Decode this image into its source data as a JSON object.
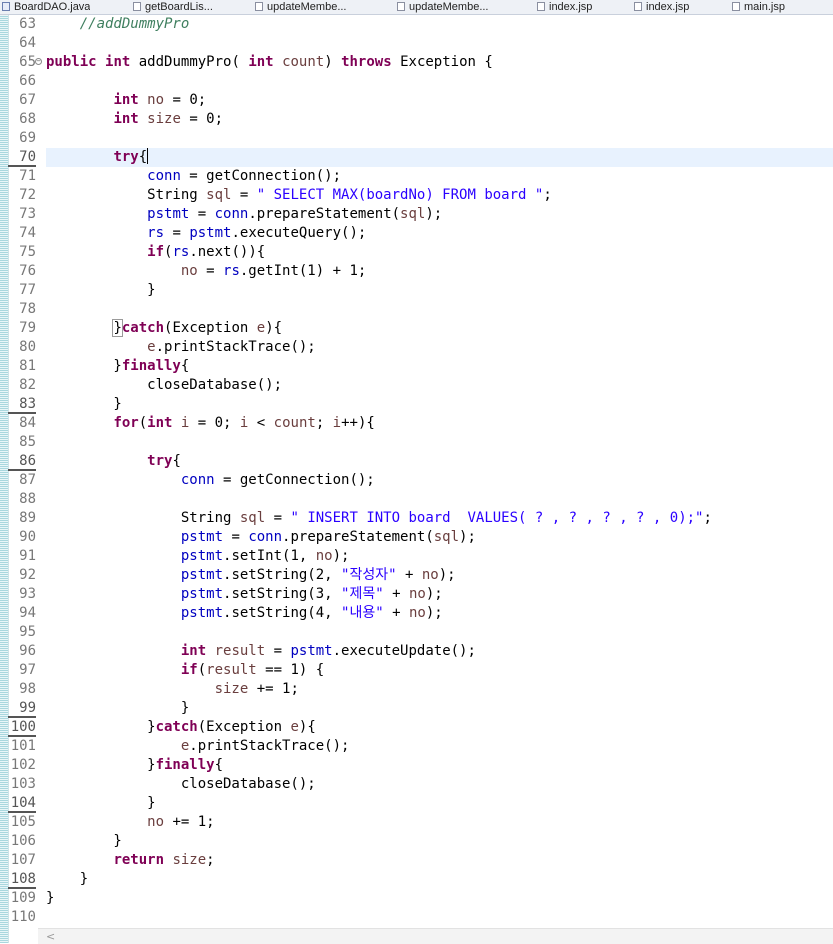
{
  "tabs": [
    {
      "label": "BoardDAO.java",
      "type": "java"
    },
    {
      "label": "getBoardLis...",
      "type": "jsp"
    },
    {
      "label": "updateMembe...",
      "type": "jsp"
    },
    {
      "label": "updateMembe...",
      "type": "jsp"
    },
    {
      "label": "index.jsp",
      "type": "jsp"
    },
    {
      "label": "index.jsp",
      "type": "jsp"
    },
    {
      "label": "main.jsp",
      "type": "jsp"
    }
  ],
  "editor": {
    "current_line": 70,
    "lines": [
      {
        "n": 63,
        "t": [
          [
            "cm",
            "    //addDummyPro"
          ]
        ]
      },
      {
        "n": 64,
        "t": []
      },
      {
        "n": 65,
        "fold": true,
        "t": [
          [
            "kw",
            "public"
          ],
          [
            "",
            " "
          ],
          [
            "kw",
            "int"
          ],
          [
            "",
            " addDummyPro( "
          ],
          [
            "kw",
            "int"
          ],
          [
            "",
            " "
          ],
          [
            "var",
            "count"
          ],
          [
            "",
            ") "
          ],
          [
            "kw",
            "throws"
          ],
          [
            "",
            " Exception {"
          ]
        ]
      },
      {
        "n": 66,
        "t": []
      },
      {
        "n": 67,
        "t": [
          [
            "",
            "        "
          ],
          [
            "kw",
            "int"
          ],
          [
            "",
            " "
          ],
          [
            "var",
            "no"
          ],
          [
            "",
            " = 0;"
          ]
        ]
      },
      {
        "n": 68,
        "t": [
          [
            "",
            "        "
          ],
          [
            "kw",
            "int"
          ],
          [
            "",
            " "
          ],
          [
            "var",
            "size"
          ],
          [
            "",
            " = 0;"
          ]
        ]
      },
      {
        "n": 69,
        "t": []
      },
      {
        "n": 70,
        "mark": true,
        "t": [
          [
            "",
            "        "
          ],
          [
            "kw",
            "try"
          ],
          [
            "",
            "{"
          ],
          [
            "caret",
            ""
          ]
        ]
      },
      {
        "n": 71,
        "t": [
          [
            "",
            "            "
          ],
          [
            "fld",
            "conn"
          ],
          [
            "",
            " = getConnection();"
          ]
        ]
      },
      {
        "n": 72,
        "t": [
          [
            "",
            "            String "
          ],
          [
            "var",
            "sql"
          ],
          [
            "",
            " = "
          ],
          [
            "str",
            "\" SELECT MAX(boardNo) FROM board \""
          ],
          [
            "",
            ";"
          ]
        ]
      },
      {
        "n": 73,
        "t": [
          [
            "",
            "            "
          ],
          [
            "fld",
            "pstmt"
          ],
          [
            "",
            " = "
          ],
          [
            "fld",
            "conn"
          ],
          [
            "",
            ".prepareStatement("
          ],
          [
            "var",
            "sql"
          ],
          [
            "",
            ");"
          ]
        ]
      },
      {
        "n": 74,
        "t": [
          [
            "",
            "            "
          ],
          [
            "fld",
            "rs"
          ],
          [
            "",
            " = "
          ],
          [
            "fld",
            "pstmt"
          ],
          [
            "",
            ".executeQuery();"
          ]
        ]
      },
      {
        "n": 75,
        "t": [
          [
            "",
            "            "
          ],
          [
            "kw",
            "if"
          ],
          [
            "",
            "("
          ],
          [
            "fld",
            "rs"
          ],
          [
            "",
            ".next()){"
          ]
        ]
      },
      {
        "n": 76,
        "t": [
          [
            "",
            "                "
          ],
          [
            "var",
            "no"
          ],
          [
            "",
            " = "
          ],
          [
            "fld",
            "rs"
          ],
          [
            "",
            ".getInt(1) + 1;"
          ]
        ]
      },
      {
        "n": 77,
        "t": [
          [
            "",
            "            }"
          ]
        ]
      },
      {
        "n": 78,
        "t": []
      },
      {
        "n": 79,
        "t": [
          [
            "",
            "        "
          ],
          [
            "box",
            "}"
          ],
          [
            "kw",
            "catch"
          ],
          [
            "",
            "(Exception "
          ],
          [
            "var",
            "e"
          ],
          [
            "",
            "){"
          ]
        ]
      },
      {
        "n": 80,
        "t": [
          [
            "",
            "            "
          ],
          [
            "var",
            "e"
          ],
          [
            "",
            ".printStackTrace();"
          ]
        ]
      },
      {
        "n": 81,
        "t": [
          [
            "",
            "        }"
          ],
          [
            "kw",
            "finally"
          ],
          [
            "",
            "{"
          ]
        ]
      },
      {
        "n": 82,
        "t": [
          [
            "",
            "            closeDatabase();"
          ]
        ]
      },
      {
        "n": 83,
        "mark": true,
        "t": [
          [
            "",
            "        }"
          ]
        ]
      },
      {
        "n": 84,
        "t": [
          [
            "",
            "        "
          ],
          [
            "kw",
            "for"
          ],
          [
            "",
            "("
          ],
          [
            "kw",
            "int"
          ],
          [
            "",
            " "
          ],
          [
            "var",
            "i"
          ],
          [
            "",
            " = 0; "
          ],
          [
            "var",
            "i"
          ],
          [
            "",
            " < "
          ],
          [
            "var",
            "count"
          ],
          [
            "",
            "; "
          ],
          [
            "var",
            "i"
          ],
          [
            "",
            "++){"
          ]
        ]
      },
      {
        "n": 85,
        "t": []
      },
      {
        "n": 86,
        "mark": true,
        "t": [
          [
            "",
            "            "
          ],
          [
            "kw",
            "try"
          ],
          [
            "",
            "{"
          ]
        ]
      },
      {
        "n": 87,
        "t": [
          [
            "",
            "                "
          ],
          [
            "fld",
            "conn"
          ],
          [
            "",
            " = getConnection();"
          ]
        ]
      },
      {
        "n": 88,
        "t": []
      },
      {
        "n": 89,
        "t": [
          [
            "",
            "                String "
          ],
          [
            "var",
            "sql"
          ],
          [
            "",
            " = "
          ],
          [
            "str",
            "\" INSERT INTO board  VALUES( ? , ? , ? , ? , 0);\""
          ],
          [
            "",
            ";"
          ]
        ]
      },
      {
        "n": 90,
        "t": [
          [
            "",
            "                "
          ],
          [
            "fld",
            "pstmt"
          ],
          [
            "",
            " = "
          ],
          [
            "fld",
            "conn"
          ],
          [
            "",
            ".prepareStatement("
          ],
          [
            "var",
            "sql"
          ],
          [
            "",
            ");"
          ]
        ]
      },
      {
        "n": 91,
        "t": [
          [
            "",
            "                "
          ],
          [
            "fld",
            "pstmt"
          ],
          [
            "",
            ".setInt(1, "
          ],
          [
            "var",
            "no"
          ],
          [
            "",
            ");"
          ]
        ]
      },
      {
        "n": 92,
        "t": [
          [
            "",
            "                "
          ],
          [
            "fld",
            "pstmt"
          ],
          [
            "",
            ".setString(2, "
          ],
          [
            "str",
            "\"작성자\""
          ],
          [
            "",
            " + "
          ],
          [
            "var",
            "no"
          ],
          [
            "",
            ");"
          ]
        ]
      },
      {
        "n": 93,
        "t": [
          [
            "",
            "                "
          ],
          [
            "fld",
            "pstmt"
          ],
          [
            "",
            ".setString(3, "
          ],
          [
            "str",
            "\"제목\""
          ],
          [
            "",
            " + "
          ],
          [
            "var",
            "no"
          ],
          [
            "",
            ");"
          ]
        ]
      },
      {
        "n": 94,
        "t": [
          [
            "",
            "                "
          ],
          [
            "fld",
            "pstmt"
          ],
          [
            "",
            ".setString(4, "
          ],
          [
            "str",
            "\"내용\""
          ],
          [
            "",
            " + "
          ],
          [
            "var",
            "no"
          ],
          [
            "",
            ");"
          ]
        ]
      },
      {
        "n": 95,
        "t": []
      },
      {
        "n": 96,
        "t": [
          [
            "",
            "                "
          ],
          [
            "kw",
            "int"
          ],
          [
            "",
            " "
          ],
          [
            "var",
            "result"
          ],
          [
            "",
            " = "
          ],
          [
            "fld",
            "pstmt"
          ],
          [
            "",
            ".executeUpdate();"
          ]
        ]
      },
      {
        "n": 97,
        "t": [
          [
            "",
            "                "
          ],
          [
            "kw",
            "if"
          ],
          [
            "",
            "("
          ],
          [
            "var",
            "result"
          ],
          [
            "",
            " == 1) {"
          ]
        ]
      },
      {
        "n": 98,
        "t": [
          [
            "",
            "                    "
          ],
          [
            "var",
            "size"
          ],
          [
            "",
            " += 1;"
          ]
        ]
      },
      {
        "n": 99,
        "mark": true,
        "t": [
          [
            "",
            "                }"
          ]
        ]
      },
      {
        "n": 100,
        "mark": true,
        "t": [
          [
            "",
            "            }"
          ],
          [
            "kw",
            "catch"
          ],
          [
            "",
            "(Exception "
          ],
          [
            "var",
            "e"
          ],
          [
            "",
            "){"
          ]
        ]
      },
      {
        "n": 101,
        "t": [
          [
            "",
            "                "
          ],
          [
            "var",
            "e"
          ],
          [
            "",
            ".printStackTrace();"
          ]
        ]
      },
      {
        "n": 102,
        "t": [
          [
            "",
            "            }"
          ],
          [
            "kw",
            "finally"
          ],
          [
            "",
            "{"
          ]
        ]
      },
      {
        "n": 103,
        "t": [
          [
            "",
            "                closeDatabase();"
          ]
        ]
      },
      {
        "n": 104,
        "mark": true,
        "t": [
          [
            "",
            "            }"
          ]
        ]
      },
      {
        "n": 105,
        "t": [
          [
            "",
            "            "
          ],
          [
            "var",
            "no"
          ],
          [
            "",
            " += 1;"
          ]
        ]
      },
      {
        "n": 106,
        "t": [
          [
            "",
            "        }"
          ]
        ]
      },
      {
        "n": 107,
        "t": [
          [
            "",
            "        "
          ],
          [
            "kw",
            "return"
          ],
          [
            "",
            " "
          ],
          [
            "var",
            "size"
          ],
          [
            "",
            ";"
          ]
        ]
      },
      {
        "n": 108,
        "mark": true,
        "t": [
          [
            "",
            "    }"
          ]
        ]
      },
      {
        "n": 109,
        "t": [
          [
            "",
            "}"
          ]
        ]
      },
      {
        "n": 110,
        "t": []
      }
    ]
  },
  "scrollbar": {
    "left_arrow": "<"
  }
}
